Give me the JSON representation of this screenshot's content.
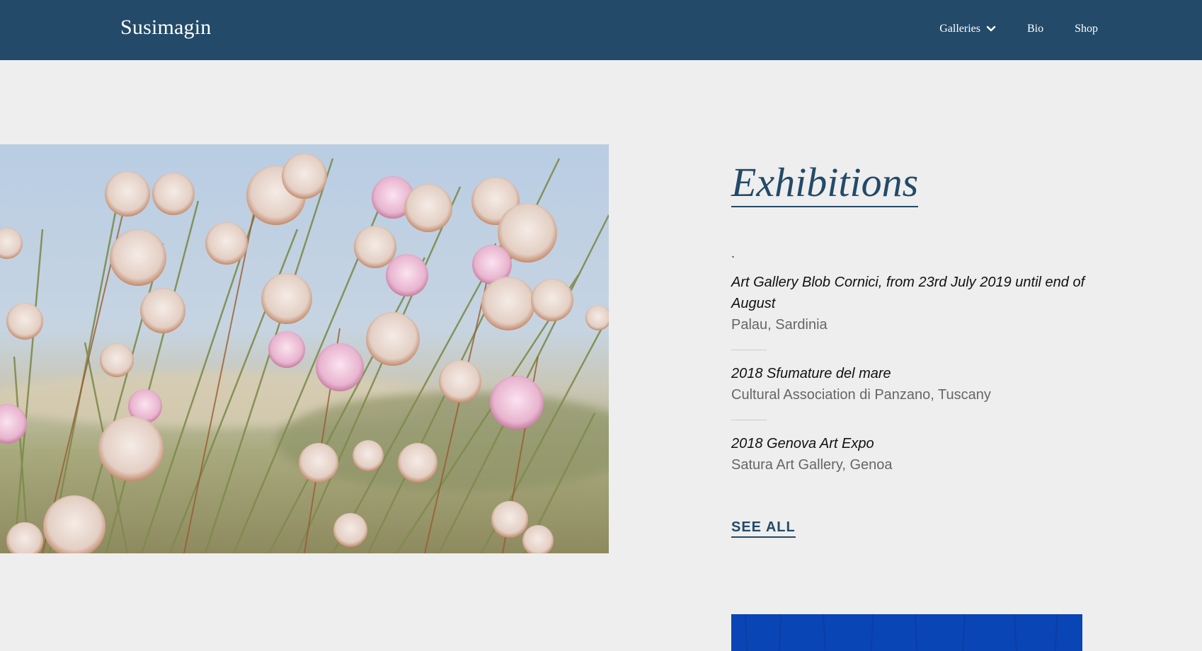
{
  "site": {
    "logo": "Susimagin"
  },
  "nav": {
    "items": [
      {
        "label": "Galleries",
        "has_dropdown": true,
        "icon": "chevron-down-icon"
      },
      {
        "label": "Bio"
      },
      {
        "label": "Shop"
      }
    ]
  },
  "colors": {
    "header_bg": "#234a68",
    "page_bg": "#eeeeee",
    "accent": "#234a68"
  },
  "hero_image": {
    "alt": "Pink and white thrift flowers in a field"
  },
  "exhibitions": {
    "heading": "Exhibitions",
    "lead": ".",
    "items": [
      {
        "title": "Art Gallery Blob Cornici, from 23rd July 2019 until end of August",
        "location": "Palau, Sardinia"
      },
      {
        "title": "2018 Sfumature del mare",
        "location": "Cultural Association di Panzano, Tuscany"
      },
      {
        "title": "2018 Genova Art Expo",
        "location": "Satura Art Gallery, Genoa"
      }
    ],
    "see_all": "SEE ALL"
  }
}
